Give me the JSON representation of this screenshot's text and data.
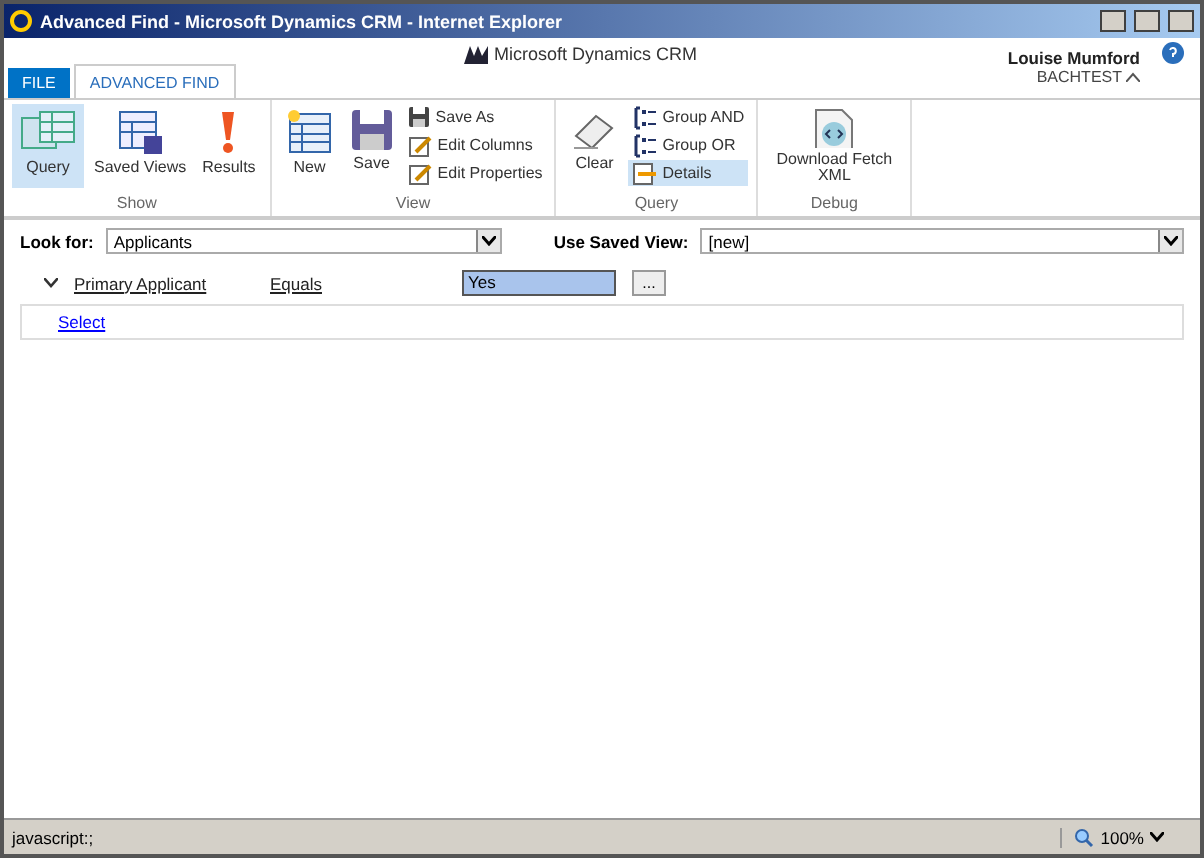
{
  "window": {
    "title": "Advanced Find - Microsoft Dynamics CRM - Internet Explorer"
  },
  "header": {
    "logo": "Microsoft Dynamics CRM",
    "user": "Louise Mumford",
    "org": "BACHTEST"
  },
  "tabs": [
    {
      "label": "FILE",
      "kind": "file",
      "selected": false
    },
    {
      "label": "ADVANCED FIND",
      "kind": "tab",
      "selected": true
    }
  ],
  "ribbon": [
    {
      "label": "Show",
      "large": [
        {
          "label": "Query",
          "kind": "query",
          "selected": true
        },
        {
          "label": "Saved Views",
          "kind": "views",
          "selected": false
        },
        {
          "label": "Results",
          "kind": "results",
          "selected": false
        }
      ]
    },
    {
      "label": "View",
      "large": [
        {
          "label": "New",
          "kind": "new",
          "selected": false
        },
        {
          "label": "Save",
          "kind": "save",
          "selected": false
        }
      ],
      "small": [
        {
          "label": "Save As",
          "kind": "save",
          "selected": false
        },
        {
          "label": "Edit Columns",
          "kind": "edit",
          "selected": false
        },
        {
          "label": "Edit Properties",
          "kind": "edit",
          "selected": false
        }
      ]
    },
    {
      "label": "Query",
      "large": [
        {
          "label": "Clear",
          "kind": "eraser",
          "selected": false
        }
      ],
      "small": [
        {
          "label": "Group AND",
          "kind": "group",
          "selected": false
        },
        {
          "label": "Group OR",
          "kind": "group",
          "selected": false
        },
        {
          "label": "Details",
          "kind": "details",
          "selected": true
        }
      ]
    },
    {
      "label": "Debug",
      "large": [
        {
          "label": "Download Fetch XML",
          "kind": "xml",
          "selected": false
        }
      ]
    }
  ],
  "look_for": {
    "label": "Look for:",
    "value": "Applicants"
  },
  "saved_view": {
    "label": "Use Saved View:",
    "value": "[new]"
  },
  "condition": {
    "field": "Primary Applicant",
    "operator": "Equals",
    "value": "Yes",
    "lookup": "...",
    "expanded": true
  },
  "select_link": "Select",
  "status_bar": {
    "text": "javascript:;",
    "zoom": "100%"
  }
}
